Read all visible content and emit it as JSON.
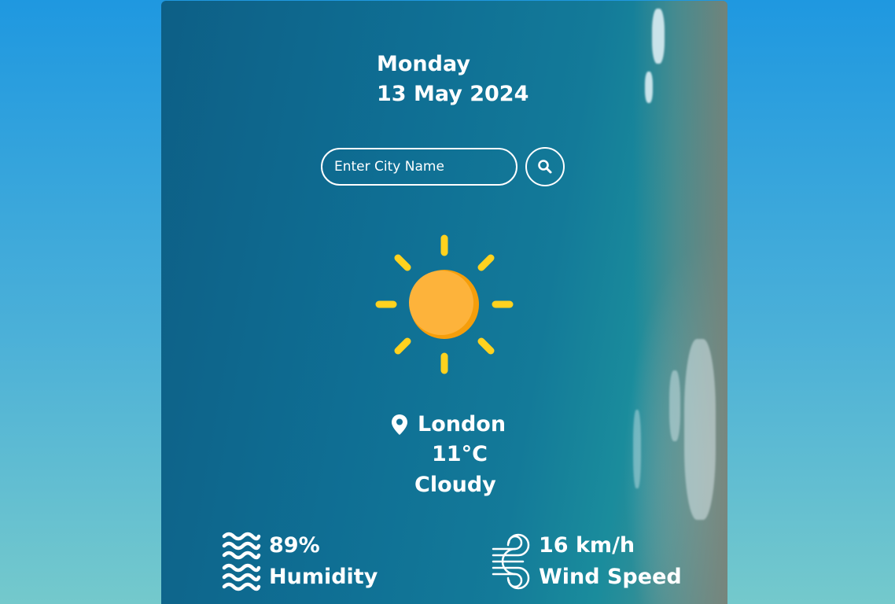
{
  "header": {
    "day": "Monday",
    "date": "13 May 2024"
  },
  "search": {
    "placeholder": "Enter City Name",
    "button_icon": "search-icon"
  },
  "weather": {
    "icon": "sun-icon",
    "location_icon": "map-pin-icon",
    "city": "London",
    "temperature": "11°C",
    "condition": "Cloudy"
  },
  "stats": {
    "humidity": {
      "icon": "waves-icon",
      "value": "89%",
      "label": "Humidity"
    },
    "wind": {
      "icon": "wind-icon",
      "value": "16 km/h",
      "label": "Wind Speed"
    }
  },
  "colors": {
    "sun_body": "#FDB33B",
    "sun_shade": "#F59E0B",
    "sun_rays": "#FFD21F",
    "text": "#FFFFFF"
  }
}
